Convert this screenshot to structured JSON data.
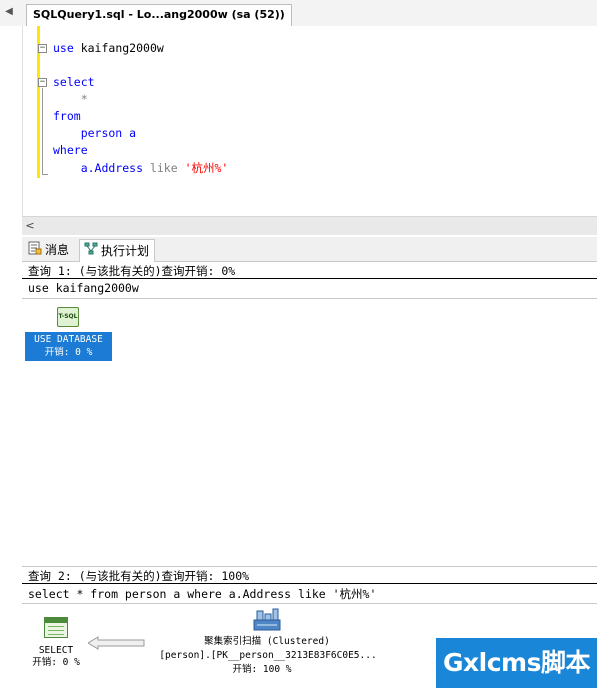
{
  "document_tab": {
    "title": "SQLQuery1.sql - Lo...ang2000w (sa (52))"
  },
  "editor": {
    "line1": {
      "kw": "use",
      "rest": " kaifang2000w"
    },
    "line2": {
      "kw": "select"
    },
    "line3": {
      "text": "    *"
    },
    "line4": {
      "kw": "from"
    },
    "line5": {
      "text": "    person a"
    },
    "line6": {
      "kw": "where"
    },
    "line7": {
      "ident": "    a.Address ",
      "op": "like",
      "space": " ",
      "str": "'杭州%'"
    }
  },
  "results_tabs": {
    "messages": "消息",
    "execution_plan": "执行计划"
  },
  "query1": {
    "header": "查询 1: (与该批有关的)查询开销: 0%",
    "sql": "use kaifang2000w",
    "node": {
      "icon_text": "T-SQL",
      "label": "USE DATABASE",
      "cost": "开销: 0 %"
    }
  },
  "query2": {
    "header": "查询 2: (与该批有关的)查询开销: 100%",
    "sql": "select * from person a where a.Address like '杭州%'",
    "select_node": {
      "label": "SELECT",
      "cost": "开销: 0 %"
    },
    "scan_node": {
      "label": "聚集索引扫描 (Clustered)",
      "object": "[person].[PK__person__3213E83F6C0E5...",
      "cost": "开销: 100 %"
    }
  },
  "watermark": {
    "text": "Gxlcms脚本"
  },
  "colors": {
    "keyword": "#0000ff",
    "string": "#ff0000",
    "operator": "#808080",
    "selected_node": "#1c7bd4",
    "change_bar": "#ffe800",
    "watermark_bg": "#1a86d8"
  }
}
